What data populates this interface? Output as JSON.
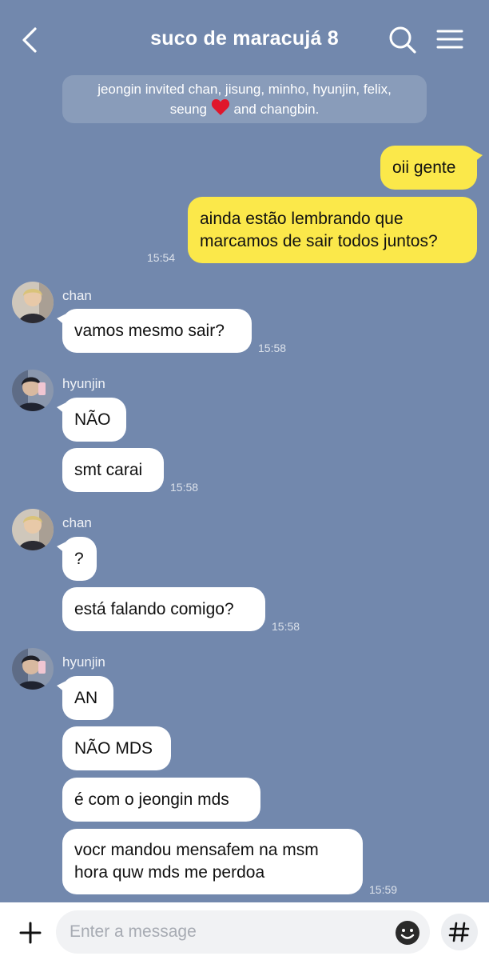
{
  "header": {
    "title": "suco de maracujá 8"
  },
  "notice": {
    "line1": "jeongin invited chan, jisung, minho, hyunjin, felix,",
    "line2_pre": "seung",
    "line2_post": "and changbin."
  },
  "messages": {
    "m1": "oii gente",
    "m2_line1": "ainda estão lembrando que",
    "m2_line2": "marcamos de sair todos juntos?",
    "t1": "15:54",
    "n1": "chan",
    "m3": "vamos mesmo sair?",
    "t2": "15:58",
    "n2": "hyunjin",
    "m4": "NÃO",
    "m5": "smt carai",
    "t3": "15:58",
    "n3": "chan",
    "m6": "?",
    "m7": "está falando comigo?",
    "t4": "15:58",
    "n4": "hyunjin",
    "m8": "AN",
    "m9": "NÃO MDS",
    "m10": "é com o jeongin mds",
    "m11_line1": "vocr mandou mensafem na msm",
    "m11_line2": "hora quw mds me perdoa",
    "t5": "15:59"
  },
  "composer": {
    "placeholder": "Enter a message"
  },
  "icons": {
    "back": "chevron-left-icon",
    "search": "search-icon",
    "menu": "menu-icon",
    "plus": "plus-icon",
    "emoji": "smiley-icon",
    "hash": "hashtag-icon",
    "heart": "heart-icon"
  },
  "colors": {
    "background": "#7288ad",
    "my_bubble": "#fbe84a",
    "their_bubble": "#ffffff"
  }
}
